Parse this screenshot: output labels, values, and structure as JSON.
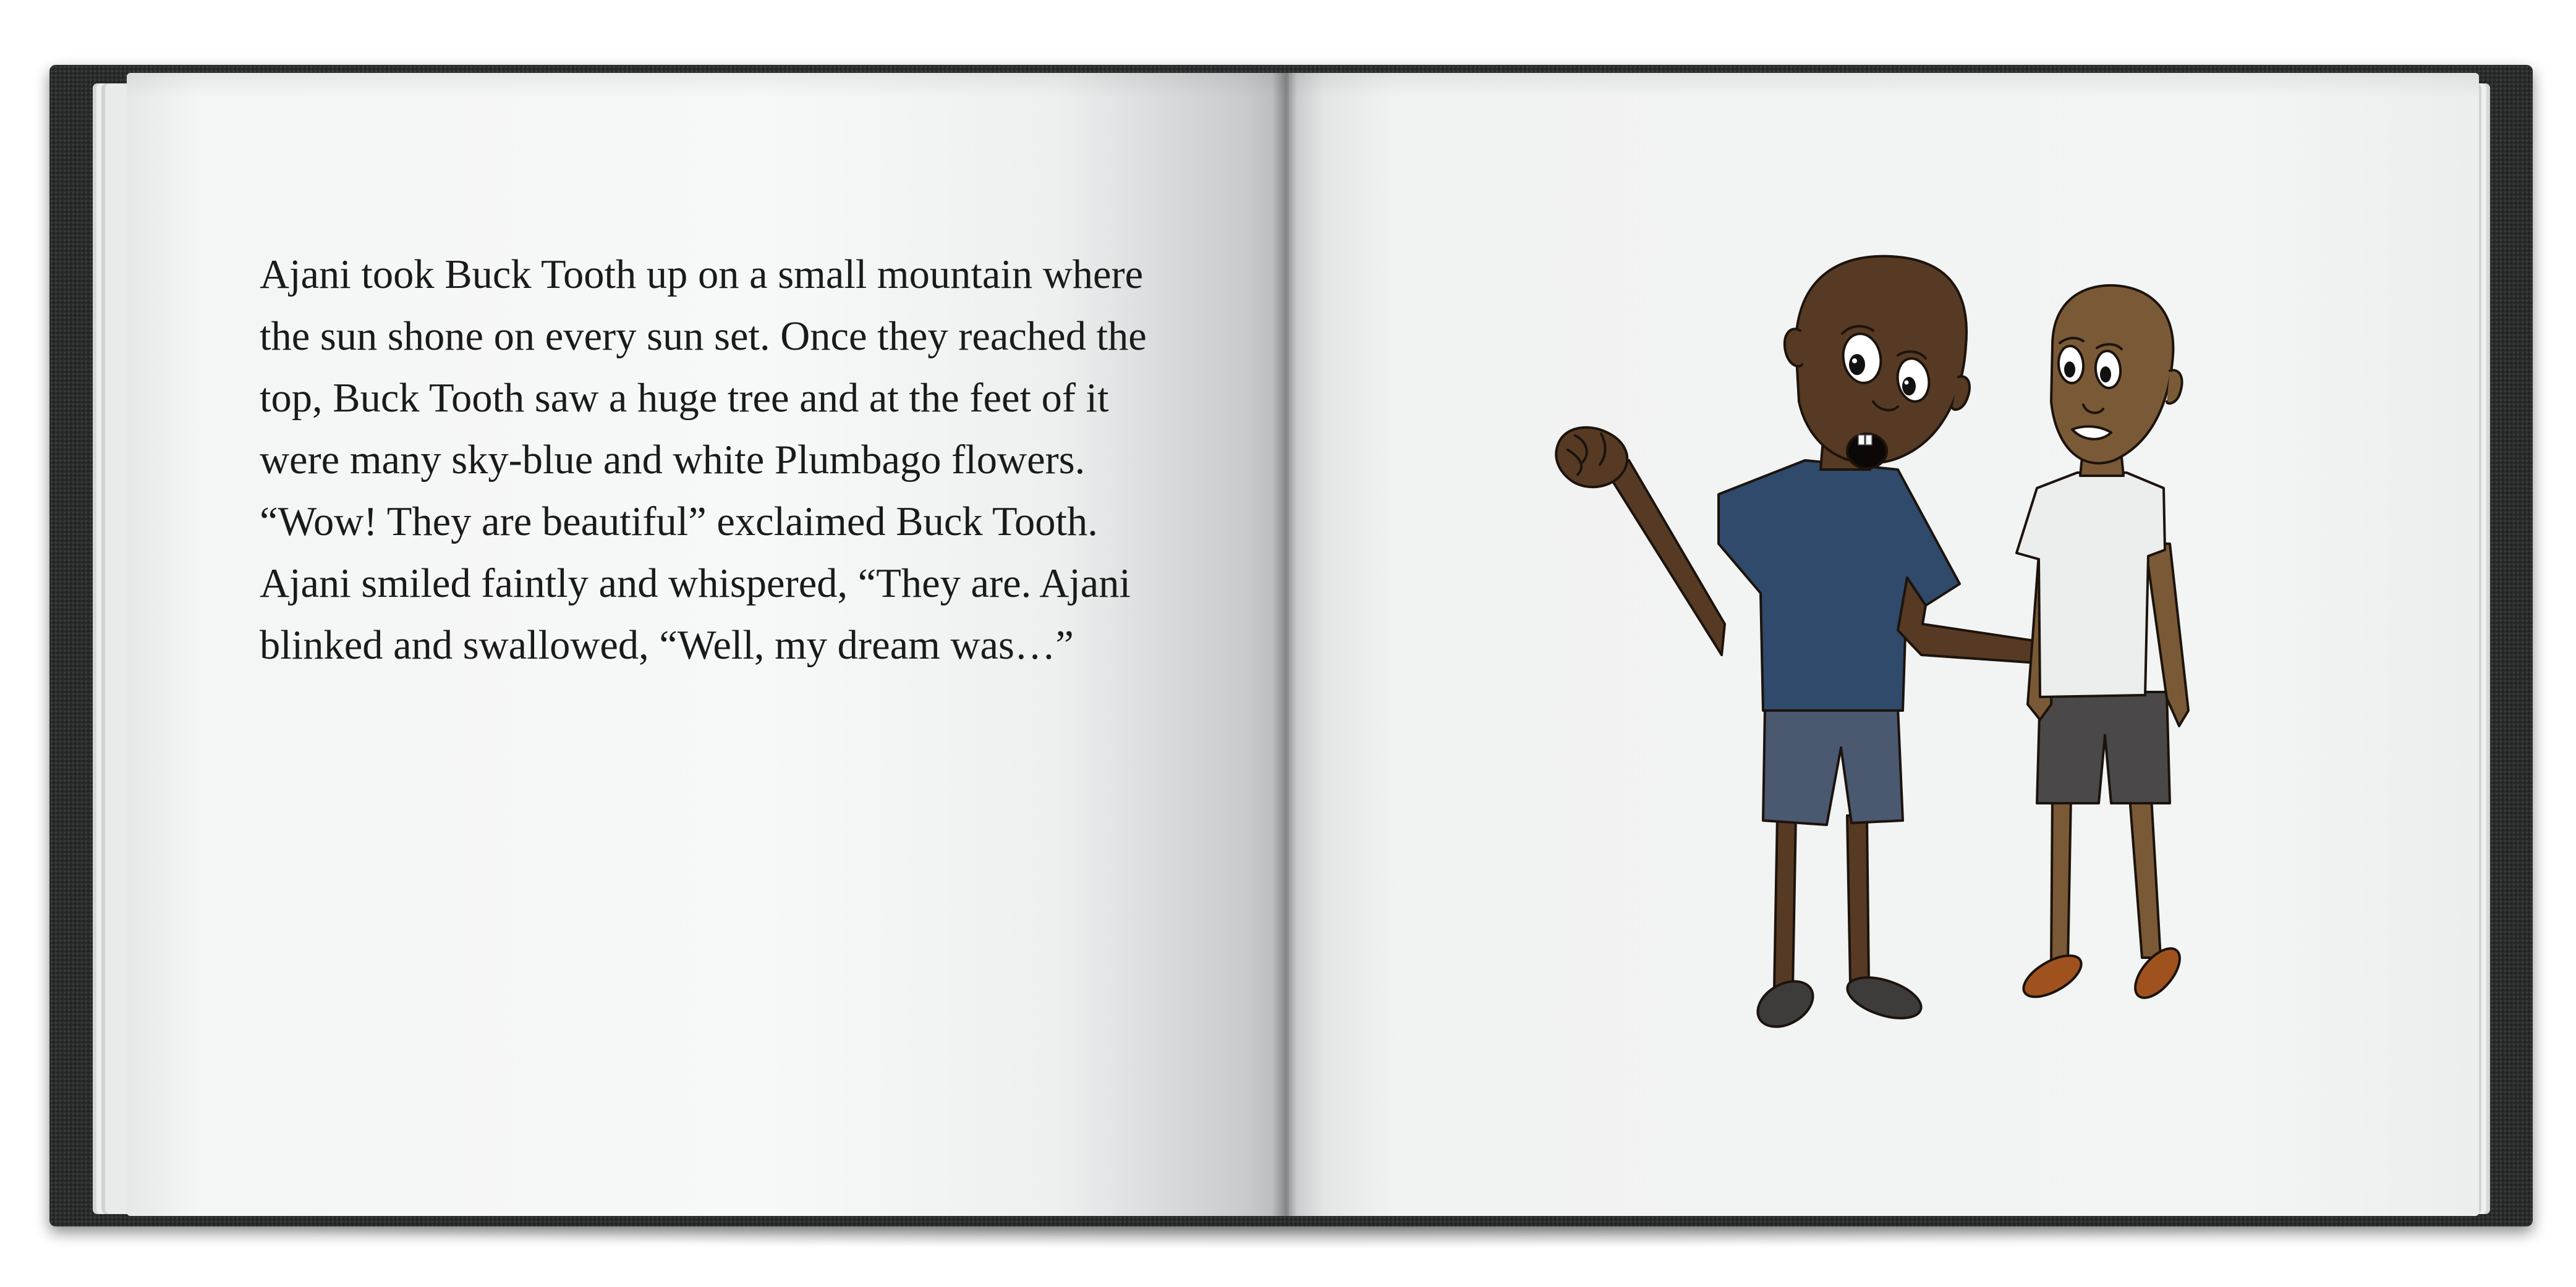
{
  "book": {
    "left_page": {
      "paragraph": "Ajani took Buck Tooth up on a small mountain where the sun shone on every sun set. Once they reached the top, Buck Tooth saw a huge tree and at the feet of it were many sky-blue and white Plumbago flowers. “Wow! They are beautiful” exclaimed Buck Tooth. Ajani smiled faintly and whispered, “They are. Ajani blinked and swallowed, “Well, my dream was…”"
    },
    "right_page": {
      "illustration": {
        "characters": [
          {
            "figure": "taller-boy",
            "shirt_color": "#2f4a6a",
            "shorts_color": "#4a5870",
            "skin_color": "#563a23",
            "shoe_color": "#3e3b3b"
          },
          {
            "figure": "shorter-boy",
            "shirt_color": "#eceded",
            "shorts_color": "#4a4848",
            "skin_color": "#7a5a36",
            "shoe_color": "#a0521e"
          }
        ]
      }
    },
    "cover_color": "#2a2d2c"
  }
}
